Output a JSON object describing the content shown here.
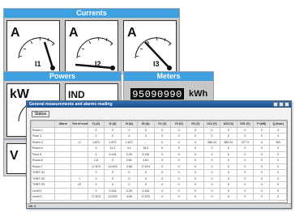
{
  "panels": {
    "currents": {
      "title": "Currents"
    },
    "powers": {
      "title": "Powers"
    },
    "meters": {
      "title": "Meters"
    }
  },
  "gauges": {
    "i1": {
      "unit": "A",
      "sub": "I1",
      "scale": [
        "0",
        "200",
        "400",
        "600"
      ]
    },
    "i2": {
      "unit": "A",
      "sub": "I2",
      "scale": [
        "0",
        "200",
        "400",
        "600"
      ]
    },
    "i3": {
      "unit": "A",
      "sub": "I3",
      "scale": [
        "0",
        "200",
        "400",
        "600"
      ]
    },
    "kw": {
      "unit": "kW",
      "scale": [
        "0",
        "20",
        "40"
      ]
    },
    "ind": {
      "unit": "IND",
      "scale": [
        "0.2",
        "0.4",
        "0.6",
        "0.8"
      ]
    },
    "v": {
      "unit": "V"
    }
  },
  "meter": {
    "value": "95090990",
    "unit": "kWh"
  },
  "window": {
    "title": "General measurements and alarms reading",
    "button": "Status",
    "columns": [
      "",
      "Alarm",
      "Set of modes",
      "I1 (A)",
      "I2 (A)",
      "I3 (A)",
      "IN (A)",
      "V1 (V)",
      "V2 (V)",
      "V3 (V)",
      "U12 (V)",
      "U23 (V)",
      "U31 (V)",
      "P (kW)",
      "Q (kvar)"
    ],
    "rows": [
      [
        "Room 1",
        "",
        "",
        "0",
        "0",
        "0",
        "0",
        "0",
        "0",
        "0",
        "0",
        "0",
        "0",
        "0",
        "0"
      ],
      [
        "Floor 1",
        "",
        "",
        "0",
        "0",
        "0",
        "0",
        "0",
        "0",
        "0",
        "0",
        "0",
        "0",
        "0",
        "0"
      ],
      [
        "Room 3",
        "",
        "LI",
        "1.872",
        "1.872",
        "1.872",
        "",
        "0",
        "0",
        "0",
        "386.24",
        "382.31",
        "377.9",
        "0",
        "300"
      ],
      [
        "Room 4",
        "",
        "",
        "0",
        "11.2",
        "4.1",
        "16.2",
        "0",
        "0",
        "0",
        "0",
        "0",
        "0",
        "0",
        "0"
      ],
      [
        "Floor 5",
        "",
        "",
        "0",
        "0.144",
        "0.25",
        "0.144",
        "0",
        "0",
        "0",
        "0",
        "0",
        "0",
        "0",
        "0"
      ],
      [
        "Room 6",
        "",
        "",
        "1.8",
        "0",
        "2.81",
        "2.81",
        "0",
        "0",
        "0",
        "0",
        "0",
        "0",
        "0",
        "0"
      ],
      [
        "Room 7",
        "",
        "",
        "17.874",
        "12.878",
        "4.98",
        "17.874",
        "0",
        "0",
        "0",
        "0",
        "0",
        "0",
        "0",
        "0"
      ],
      [
        "TGBT G1",
        "",
        "",
        "0",
        "0",
        "0",
        "0",
        "0",
        "0",
        "0",
        "0",
        "0",
        "0",
        "0",
        "0"
      ],
      [
        "TGBT G2",
        "",
        "I",
        "0",
        "0",
        "0",
        "0",
        "0",
        "0",
        "0",
        "0",
        "0",
        "0",
        "0",
        "0"
      ],
      [
        "TGBT G3",
        "",
        "LP",
        "0",
        "0",
        "0",
        "0",
        "0",
        "0",
        "0",
        "0",
        "0",
        "0",
        "0",
        "0"
      ],
      [
        "Level 1",
        "",
        "",
        "0",
        "0.144",
        "0.25",
        "0.144",
        "0",
        "0",
        "0",
        "0",
        "0",
        "0",
        "0",
        "0"
      ],
      [
        "Level 2",
        "",
        "",
        "17.874",
        "12.878",
        "4.98",
        "17.874",
        "0",
        "0",
        "0",
        "0",
        "0",
        "0",
        "0",
        "0"
      ]
    ],
    "status": "NE-4"
  },
  "colors": {
    "accent": "#3ea0e0",
    "panel": "#c7c7c7",
    "titlebar": "#1d4f8c"
  }
}
